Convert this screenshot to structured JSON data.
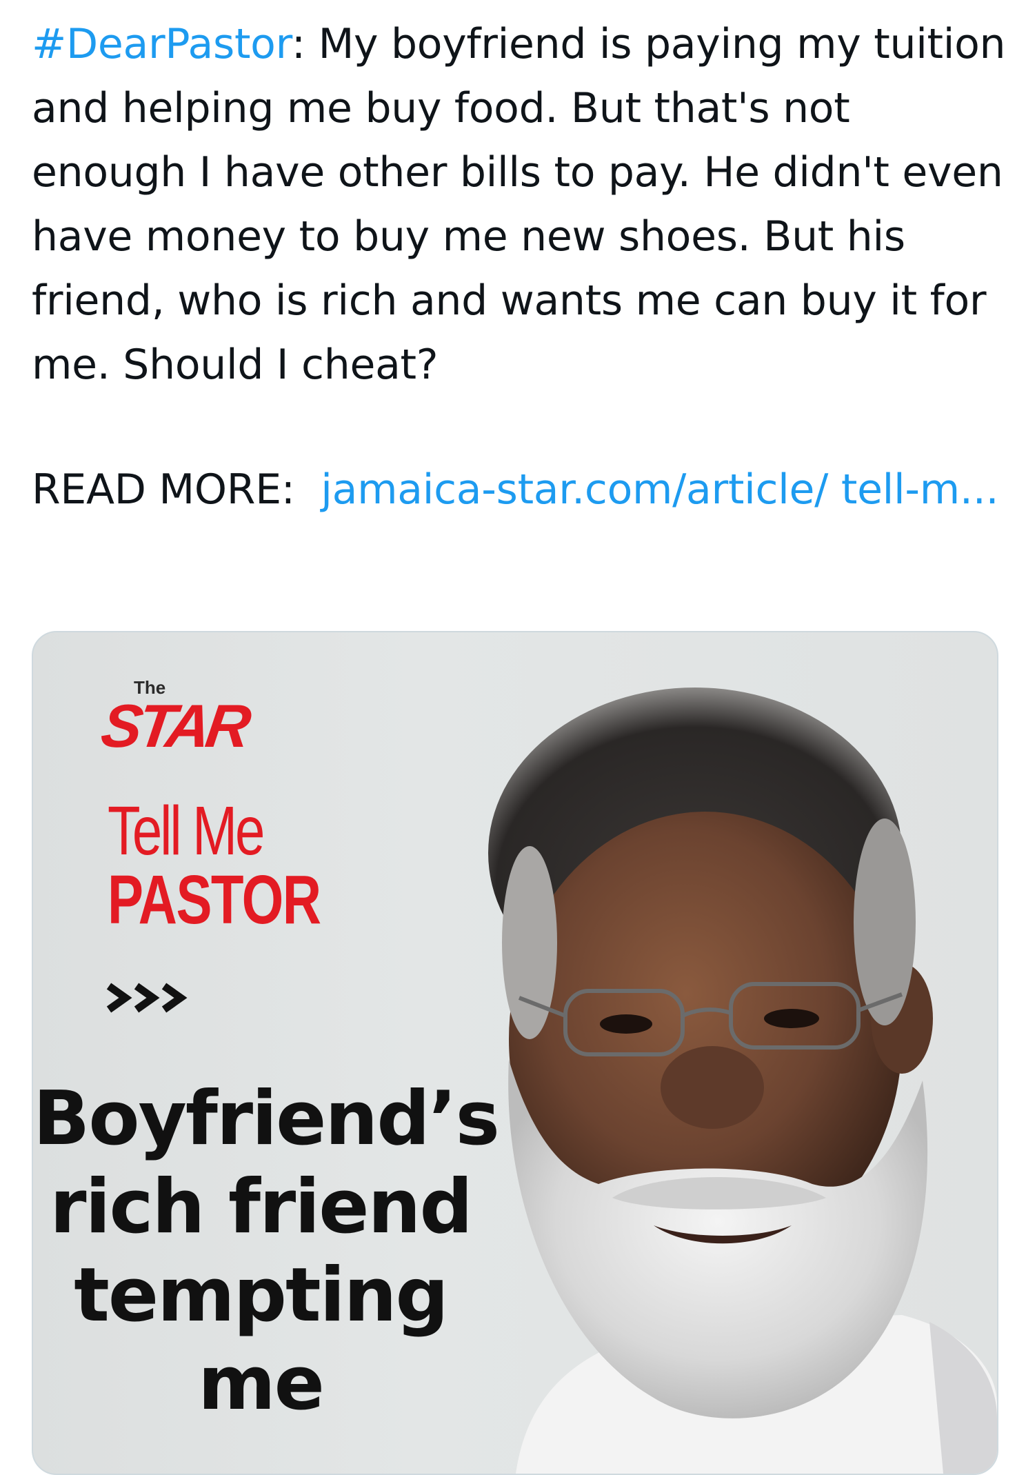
{
  "tweet": {
    "hashtag": "#DearPastor",
    "body": ": My boyfriend is paying my tuition and helping me buy food. But that's not enough I have other bills to pay. He didn't even have money to buy me new shoes. But his friend, who is rich and wants me can buy it for me. Should I cheat?",
    "read_more_label": "READ MORE:",
    "link_text": "jamaica-star.com/article/ tell-m..."
  },
  "card": {
    "logo_the": "The",
    "logo_star": "STAR",
    "series_line1": "Tell Me",
    "series_line2": "PASTOR",
    "headline_lines": [
      "Boyfriend’s",
      "rich friend",
      "tempting",
      "me"
    ]
  },
  "colors": {
    "link": "#1d9bf0",
    "brand_red": "#e31b23",
    "text": "#0f1419",
    "card_border": "#cfd9de"
  }
}
